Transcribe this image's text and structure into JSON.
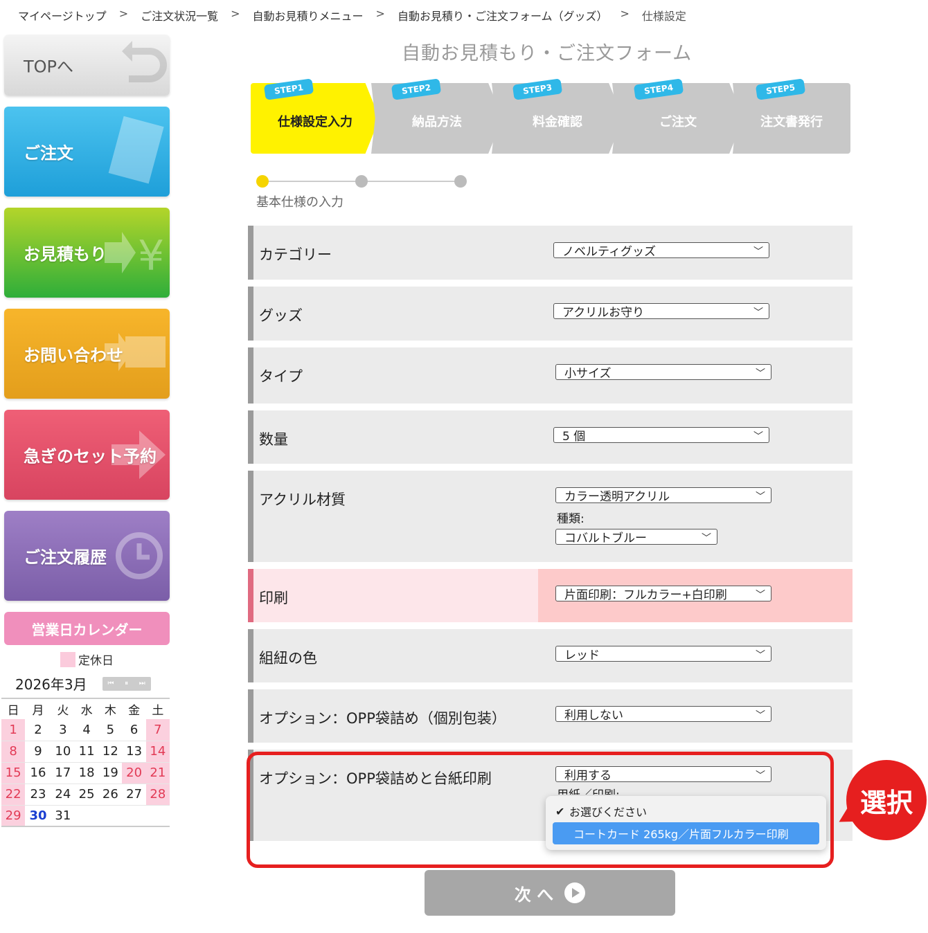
{
  "breadcrumb": [
    "マイページトップ",
    "ご注文状況一覧",
    "自動お見積りメニュー",
    "自動お見積り・ご注文フォーム（グッズ）",
    "仕様設定"
  ],
  "breadcrumb_sep": ">",
  "sidebar": {
    "top": "TOPへ",
    "order": "ご注文",
    "estimate": "お見積もり",
    "contact": "お問い合わせ",
    "rush": "急ぎのセット予約",
    "history": "ご注文履歴"
  },
  "calendar": {
    "title": "営業日カレンダー",
    "legend": "定休日",
    "month": "2026年3月",
    "nav": [
      "⏮",
      "⏸",
      "⏭"
    ],
    "weekdays": [
      "日",
      "月",
      "火",
      "水",
      "木",
      "金",
      "土"
    ],
    "weeks": [
      [
        "1",
        "2",
        "3",
        "4",
        "5",
        "6",
        "7"
      ],
      [
        "8",
        "9",
        "10",
        "11",
        "12",
        "13",
        "14"
      ],
      [
        "15",
        "16",
        "17",
        "18",
        "19",
        "20",
        "21"
      ],
      [
        "22",
        "23",
        "24",
        "25",
        "26",
        "27",
        "28"
      ],
      [
        "29",
        "30",
        "31",
        "",
        "",
        "",
        ""
      ]
    ]
  },
  "form_title": "自動お見積もり・ご注文フォーム",
  "steps": [
    {
      "tag": "STEP1",
      "name": "仕様設定入力"
    },
    {
      "tag": "STEP2",
      "name": "納品方法"
    },
    {
      "tag": "STEP3",
      "name": "料金確認"
    },
    {
      "tag": "STEP4",
      "name": "ご注文"
    },
    {
      "tag": "STEP5",
      "name": "注文書発行"
    }
  ],
  "progress_label": "基本仕様の入力",
  "rows": {
    "category": {
      "label": "カテゴリー",
      "value": "ノベルティグッズ"
    },
    "goods": {
      "label": "グッズ",
      "value": "アクリルお守り"
    },
    "type": {
      "label": "タイプ",
      "value": "小サイズ"
    },
    "qty": {
      "label": "数量",
      "value": "5 個"
    },
    "material": {
      "label": "アクリル材質",
      "value": "カラー透明アクリル",
      "sub_label": "種類:",
      "sub_value": "コバルトブルー"
    },
    "print": {
      "label": "印刷",
      "value": "片面印刷：フルカラー+白印刷"
    },
    "cord": {
      "label": "組紐の色",
      "value": "レッド"
    },
    "opp": {
      "label": "オプション：OPP袋詰め（個別包装）",
      "value": "利用しない"
    },
    "opp_card": {
      "label": "オプション：OPP袋詰めと台紙印刷",
      "value": "利用する",
      "sub_label": "用紙／印刷:"
    }
  },
  "dropdown": {
    "option1": "お選びください",
    "option2": "コートカード 265kg／片面フルカラー印刷"
  },
  "badge": "選択",
  "next_button": "次 へ"
}
